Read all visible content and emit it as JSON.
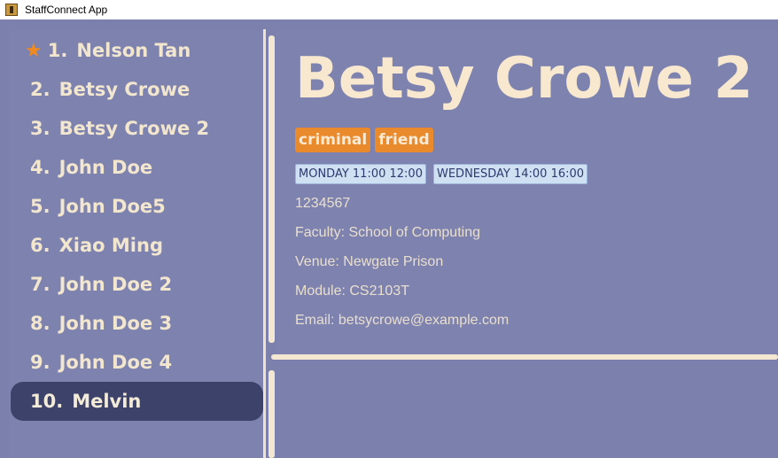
{
  "window": {
    "title": "StaffConnect App"
  },
  "sidebar": {
    "items": [
      {
        "index": "1.",
        "name": "Nelson Tan",
        "favourite": true
      },
      {
        "index": "2.",
        "name": "Betsy Crowe"
      },
      {
        "index": "3.",
        "name": "Betsy Crowe 2"
      },
      {
        "index": "4.",
        "name": "John Doe"
      },
      {
        "index": "5.",
        "name": "John Doe5"
      },
      {
        "index": "6.",
        "name": "Xiao Ming"
      },
      {
        "index": "7.",
        "name": "John Doe 2"
      },
      {
        "index": "8.",
        "name": "John Doe 3"
      },
      {
        "index": "9.",
        "name": "John Doe 4"
      },
      {
        "index": "10.",
        "name": "Melvin",
        "selected": true
      }
    ]
  },
  "detail": {
    "name": "Betsy Crowe 2",
    "tags": [
      "criminal",
      "friend"
    ],
    "availabilities": [
      "MONDAY 11:00 12:00",
      "WEDNESDAY 14:00 16:00"
    ],
    "phone": "1234567",
    "faculty": "Faculty:  School of Computing",
    "venue": "Venue:  Newgate Prison",
    "module": "Module:  CS2103T",
    "email": "Email:  betsycrowe@example.com"
  },
  "colors": {
    "background": "#7d82ae",
    "selected": "#3d426a",
    "tag": "#e98a2c",
    "slot": "#cfe0f3",
    "text": "#f2e6cf",
    "star": "#ef8a22"
  },
  "icons": {
    "favourite": "star-icon",
    "app": "app-icon"
  }
}
